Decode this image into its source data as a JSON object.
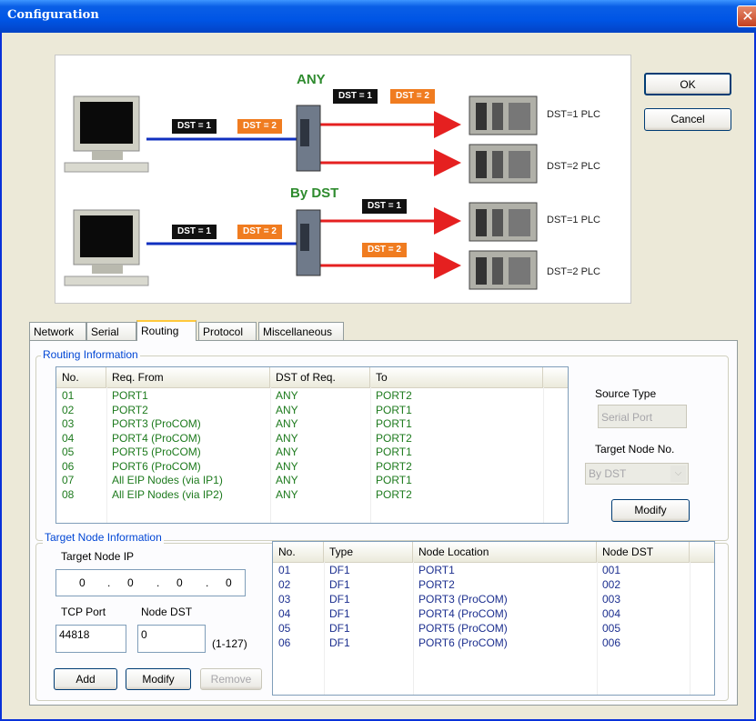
{
  "window": {
    "title": "Configuration",
    "close_glyph": "✕"
  },
  "diagram": {
    "mode_any": "ANY",
    "mode_by_dst": "By DST",
    "tag_dst1": "DST = 1",
    "tag_dst2": "DST = 2",
    "plc_labels": [
      "DST=1 PLC",
      "DST=2 PLC",
      "DST=1 PLC",
      "DST=2 PLC"
    ]
  },
  "buttons": {
    "ok": "OK",
    "cancel": "Cancel"
  },
  "tabs": [
    "Network",
    "Serial",
    "Routing",
    "Protocol",
    "Miscellaneous"
  ],
  "active_tab": "Routing",
  "routing": {
    "group_title": "Routing Information",
    "columns": [
      "No.",
      "Req. From",
      "DST of Req.",
      "To"
    ],
    "rows": [
      [
        "01",
        "PORT1",
        "ANY",
        "PORT2"
      ],
      [
        "02",
        "PORT2",
        "ANY",
        "PORT1"
      ],
      [
        "03",
        "PORT3 (ProCOM)",
        "ANY",
        "PORT1"
      ],
      [
        "04",
        "PORT4 (ProCOM)",
        "ANY",
        "PORT2"
      ],
      [
        "05",
        "PORT5 (ProCOM)",
        "ANY",
        "PORT1"
      ],
      [
        "06",
        "PORT6 (ProCOM)",
        "ANY",
        "PORT2"
      ],
      [
        "07",
        "All EIP Nodes (via IP1)",
        "ANY",
        "PORT1"
      ],
      [
        "08",
        "All EIP Nodes (via IP2)",
        "ANY",
        "PORT2"
      ]
    ],
    "source_type_label": "Source Type",
    "source_type_value": "Serial Port",
    "target_node_no_label": "Target Node No.",
    "target_node_no_value": "By DST",
    "modify": "Modify"
  },
  "target": {
    "group_title": "Target Node Information",
    "ip_label": "Target Node IP",
    "ip_octets": [
      "0",
      "0",
      "0",
      "0"
    ],
    "tcp_port_label": "TCP Port",
    "tcp_port_value": "44818",
    "node_dst_label": "Node DST",
    "node_dst_value": "0",
    "node_dst_range": "(1-127)",
    "add": "Add",
    "modify": "Modify",
    "remove": "Remove",
    "columns": [
      "No.",
      "Type",
      "Node Location",
      "Node DST"
    ],
    "rows": [
      [
        "01",
        "DF1",
        "PORT1",
        "001"
      ],
      [
        "02",
        "DF1",
        "PORT2",
        "002"
      ],
      [
        "03",
        "DF1",
        "PORT3 (ProCOM)",
        "003"
      ],
      [
        "04",
        "DF1",
        "PORT4 (ProCOM)",
        "004"
      ],
      [
        "05",
        "DF1",
        "PORT5 (ProCOM)",
        "005"
      ],
      [
        "06",
        "DF1",
        "PORT6 (ProCOM)",
        "006"
      ]
    ]
  },
  "colors": {
    "titlebar": "#0055e5",
    "green_text": "#1d7a1d",
    "navy_text": "#1c2f8f",
    "group_title": "#0046d5",
    "tag_orange": "#f07c20"
  }
}
